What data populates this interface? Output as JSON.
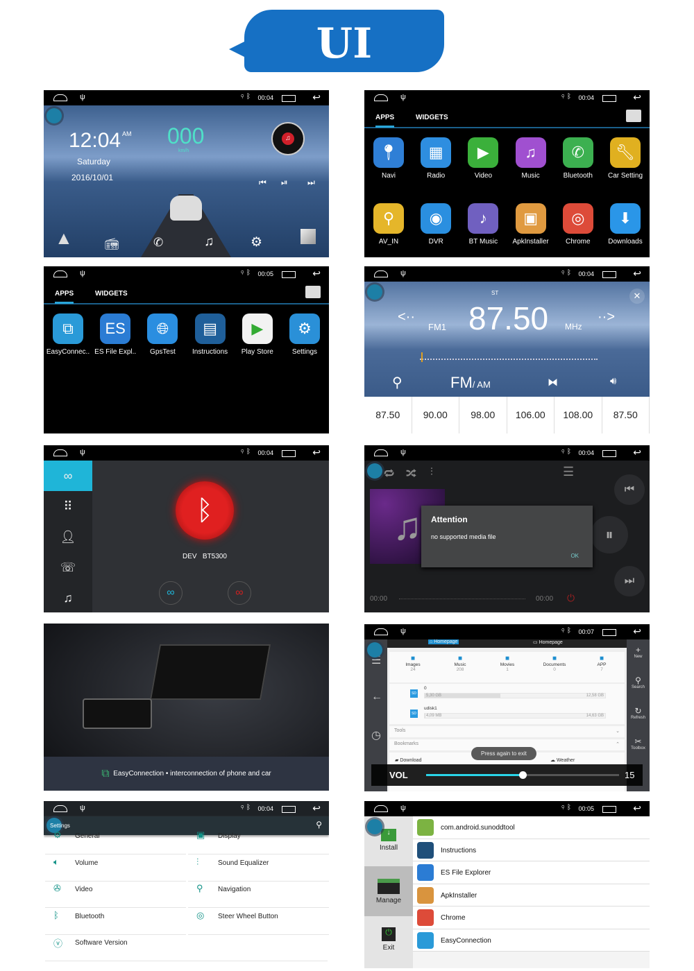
{
  "banner": {
    "title": "UI"
  },
  "home": {
    "time": "00:04",
    "clock": "12:04",
    "ampm": "AM",
    "day": "Saturday",
    "date": "2016/10/01",
    "speed": "000",
    "speed_unit": "km/h"
  },
  "apps1": {
    "time": "00:04",
    "tab_apps": "APPS",
    "tab_widgets": "WIDGETS",
    "items": [
      {
        "label": "Navi",
        "color": "#2f7fd6",
        "icon": "map-pin-icon"
      },
      {
        "label": "Radio",
        "color": "#2e8ee0",
        "icon": "radio-icon"
      },
      {
        "label": "Video",
        "color": "#3bb03b",
        "icon": "play-icon"
      },
      {
        "label": "Music",
        "color": "#a050d0",
        "icon": "music-note-icon"
      },
      {
        "label": "Bluetooth",
        "color": "#3cb050",
        "icon": "phone-icon"
      },
      {
        "label": "Car Setting",
        "color": "#e0b020",
        "icon": "wrench-icon"
      },
      {
        "label": "AV_IN",
        "color": "#e5b62a",
        "icon": "plug-icon"
      },
      {
        "label": "DVR",
        "color": "#2a8fe0",
        "icon": "camera-icon"
      },
      {
        "label": "BT Music",
        "color": "#7060c0",
        "icon": "bt-music-icon"
      },
      {
        "label": "ApkInstaller",
        "color": "#e09a40",
        "icon": "box-icon"
      },
      {
        "label": "Chrome",
        "color": "#dd4b39",
        "icon": "chrome-icon"
      },
      {
        "label": "Downloads",
        "color": "#2a96e8",
        "icon": "download-icon"
      }
    ]
  },
  "apps2": {
    "time": "00:05",
    "tab_apps": "APPS",
    "tab_widgets": "WIDGETS",
    "items": [
      {
        "label": "EasyConnec..",
        "color": "#2a9ad8",
        "icon": "easyconnection-icon"
      },
      {
        "label": "ES File Expl..",
        "color": "#2b7cd4",
        "icon": "es-file-icon"
      },
      {
        "label": "GpsTest",
        "color": "#2a8ee0",
        "icon": "globe-icon"
      },
      {
        "label": "Instructions",
        "color": "#1f5f9a",
        "icon": "book-icon"
      },
      {
        "label": "Play Store",
        "color": "#f2f2f2",
        "icon": "play-store-icon"
      },
      {
        "label": "Settings",
        "color": "#2a90d8",
        "icon": "gear-icon"
      }
    ]
  },
  "radio": {
    "time": "00:04",
    "st": "ST",
    "band": "FM1",
    "freq": "87.50",
    "unit": "MHz",
    "mode_main": "FM",
    "mode_alt": "/ AM",
    "presets": [
      "87.50",
      "90.00",
      "98.00",
      "106.00",
      "108.00",
      "87.50"
    ]
  },
  "bt": {
    "time": "00:04",
    "device_label": "DEV",
    "device_name": "BT5300"
  },
  "music": {
    "time": "00:04",
    "dialog_title": "Attention",
    "dialog_message": "no supported media file",
    "dialog_ok": "OK",
    "elapsed": "00:00",
    "total": "00:00"
  },
  "easy": {
    "caption": "EasyConnection • interconnection of phone and car"
  },
  "files": {
    "time": "00:07",
    "tab_left": "Homepage",
    "tab_right": "Homepage",
    "categories": [
      {
        "label": "Images",
        "count": "24"
      },
      {
        "label": "Music",
        "count": "208"
      },
      {
        "label": "Movies",
        "count": "1"
      },
      {
        "label": "Documents",
        "count": "0"
      },
      {
        "label": "APP",
        "count": "7"
      }
    ],
    "storage": [
      {
        "name": "0",
        "used": "5,30 GB",
        "total": "12,58 GB",
        "fill": 0.42
      },
      {
        "name": "udisk1",
        "used": "4,09 MB",
        "total": "14,63 GB",
        "fill": 0.001
      }
    ],
    "tools": "Tools",
    "bookmarks": "Bookmarks",
    "download": "Download",
    "weather": "Weather",
    "toast": "Press again to exit",
    "vol_label": "VOL",
    "vol_value": "15",
    "vol_level": 0.5,
    "right": [
      "New",
      "Search",
      "Refresh",
      "Toolbox"
    ]
  },
  "settings": {
    "time": "00:04",
    "title": "Settings",
    "items": [
      "General",
      "Display",
      "Volume",
      "Sound Equalizer",
      "Video",
      "Navigation",
      "Bluetooth",
      "Steer Wheel Button",
      "Software Version"
    ]
  },
  "appman": {
    "time": "00:05",
    "install": "Install",
    "manage": "Manage",
    "exit": "Exit",
    "items": [
      {
        "label": "com.android.sunoddtool",
        "color": "#7cb342"
      },
      {
        "label": "Instructions",
        "color": "#1f4f7a"
      },
      {
        "label": "ES File Explorer",
        "color": "#2b7cd4"
      },
      {
        "label": "ApkInstaller",
        "color": "#d9943e"
      },
      {
        "label": "Chrome",
        "color": "#dd4b39"
      },
      {
        "label": "EasyConnection",
        "color": "#2a9ad8"
      }
    ]
  }
}
